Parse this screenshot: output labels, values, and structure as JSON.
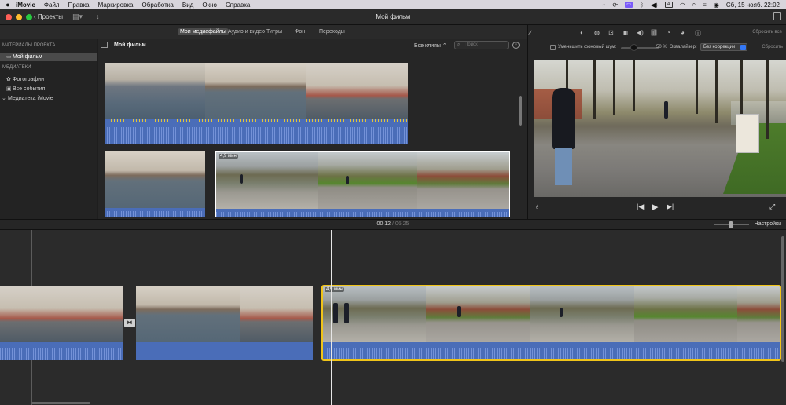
{
  "menubar": {
    "app": "iMovie",
    "items": [
      "Файл",
      "Правка",
      "Маркировка",
      "Обработка",
      "Вид",
      "Окно",
      "Справка"
    ],
    "clock": "Сб, 15 нояб.  22:02",
    "input_source": "A"
  },
  "toolbar": {
    "back_label": "Проекты",
    "window_title": "Мой фильм"
  },
  "browser_tabs": [
    "Мои медиафайлы",
    "Аудио и видео",
    "Титры",
    "Фон",
    "Переходы"
  ],
  "sidebar": {
    "section_project": "МАТЕРИАЛЫ ПРОЕКТА",
    "project_item": "Мой фильм",
    "section_media": "МЕДИАТЕКИ",
    "photos": "Фотографии",
    "all_events": "Все события",
    "library": "Медиатека iMovie"
  },
  "browser": {
    "title": "Мой фильм",
    "filter": "Все клипы",
    "search_placeholder": "Поиск",
    "clip_duration": "4,9 мин"
  },
  "viewer": {
    "reset_all": "Сбросить все",
    "noise_reduction_label": "Уменьшить фоновый шум:",
    "noise_reduction_value": "50 %",
    "equalizer_label": "Эквалайзер:",
    "equalizer_value": "Без коррекции",
    "reset": "Сбросить"
  },
  "timeline": {
    "current_time": "00:12",
    "separator": " / ",
    "total_time": "05:25",
    "settings": "Настройки",
    "clip_duration": "4,9 мин"
  },
  "colors": {
    "accent": "#7a5af8",
    "selection": "#f0c419",
    "waveform": "#4a6db8",
    "peak": "#e3c43a"
  }
}
